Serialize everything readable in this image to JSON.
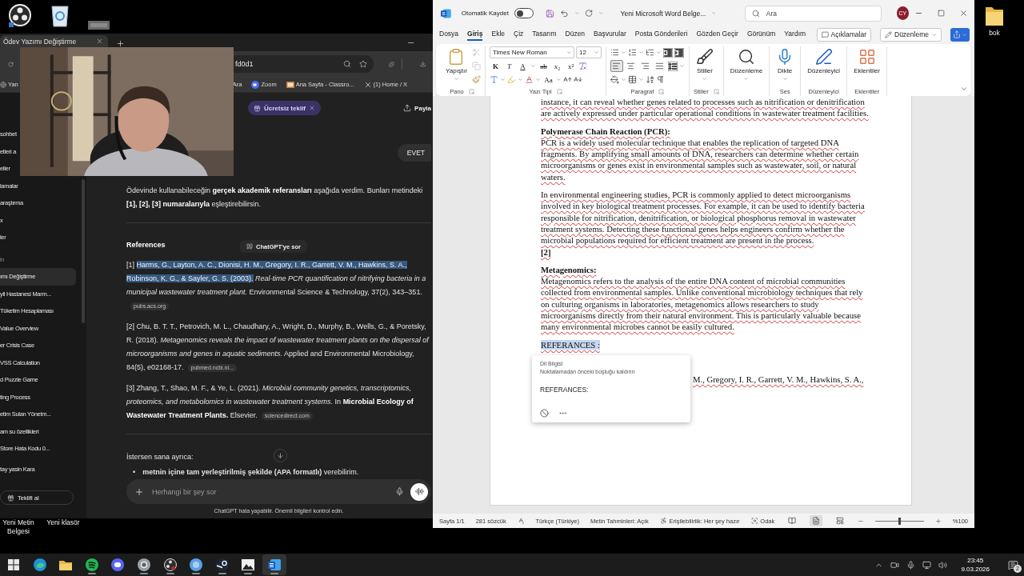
{
  "desktop": {
    "top_icons": [
      {
        "kind": "recorder"
      },
      {
        "kind": "recycle"
      },
      {
        "kind": "thumbnail"
      }
    ],
    "folder": {
      "label": "bok"
    },
    "bottom_icons": [
      {
        "label": "Yeni Metin Belgesi"
      },
      {
        "label": "Yeni klasör"
      }
    ]
  },
  "browser": {
    "tab_title": "Ödev Yazımı Değiştirme",
    "address": "fd0d1",
    "bookmarks": [
      {
        "label": "Yan",
        "kind": "globe"
      },
      {
        "label": "Ara",
        "kind": "plain"
      },
      {
        "label": "Zoom",
        "kind": "video"
      },
      {
        "label": "Ana Sayfa - Classro...",
        "kind": "board"
      },
      {
        "label": "(1) Home / X",
        "kind": "cross"
      }
    ],
    "sidebar": {
      "items": [
        {
          "label": "sohbet",
          "kind": "item",
          "selected": false
        },
        {
          "label": "etleri a",
          "kind": "item",
          "selected": false
        },
        {
          "label": "eller",
          "kind": "item",
          "selected": false
        },
        {
          "label": "lamalar",
          "kind": "item",
          "selected": false
        },
        {
          "label": "araştırma",
          "kind": "item",
          "selected": false
        },
        {
          "label": "x",
          "kind": "item",
          "selected": false
        },
        {
          "label": "ler",
          "kind": "item",
          "selected": false
        },
        {
          "label": "in",
          "kind": "section"
        },
        {
          "label": "ımı Değiştirme",
          "kind": "item",
          "selected": true
        },
        {
          "label": "yli Hastanesi Marm...",
          "kind": "item",
          "selected": false
        },
        {
          "label": "Tüketim Hesaplaması",
          "kind": "item",
          "selected": false
        },
        {
          "label": "Value Overview",
          "kind": "item",
          "selected": false
        },
        {
          "label": "er Crisis Case",
          "kind": "item",
          "selected": false
        },
        {
          "label": "VSS Calculation",
          "kind": "item",
          "selected": false
        },
        {
          "label": "d Puzzle Game",
          "kind": "item",
          "selected": false
        },
        {
          "label": "ting Process",
          "kind": "item",
          "selected": false
        },
        {
          "label": "etim Sulan Yönetm...",
          "kind": "item",
          "selected": false
        },
        {
          "label": "am su özellikleri",
          "kind": "item",
          "selected": false
        },
        {
          "label": "Store Hata Kodu 0...",
          "kind": "item",
          "selected": false
        }
      ],
      "user": "tay yasin Kara",
      "offer_button": "Teklifi al"
    },
    "chat": {
      "offer_pill": "Ücretsiz teklif",
      "share": "Payla",
      "user_message": "EVET",
      "intro": "Ödevinde kullanabileceğin **gerçek akademik referansları** aşağıda verdim. Bunları metindeki **[1], [2], [3] numaralarıyla** eşleştirebilirsin.",
      "references_title": "References",
      "quote_tooltip": "ChatGPT'ye sor",
      "references": [
        {
          "number": "[1]",
          "authors": "Harms, G., Layton, A. C., Dionisi, H. M., Gregory, I. R., Garrett, V. M., Hawkins, S. A., Robinson, K. G., & Sayler, G. S. (2003).",
          "authors_selected": true,
          "rest": "*Real-time PCR quantification of nitrifying bacteria in a municipal wastewater treatment plant.* Environmental Science & Technology, 37(2), 343–351.",
          "source": "pubs.acs.org"
        },
        {
          "number": "[2]",
          "authors": "Chu, B. T. T., Petrovich, M. L., Chaudhary, A., Wright, D., Murphy, B., Wells, G., & Poretsky, R. (2018).",
          "authors_selected": false,
          "rest": "*Metagenomics reveals the impact of wastewater treatment plants on the dispersal of microorganisms and genes in aquatic sediments.* Applied and Environmental Microbiology, 84(5), e02168-17.",
          "source": "pubmed.ncbi.nl..."
        },
        {
          "number": "[3]",
          "authors": "Zhang, T., Shao, M. F., & Ye, L. (2021).",
          "authors_selected": false,
          "rest": "*Microbial community genetics, transcriptomics, proteomics, and metabolomics in wastewater treatment systems.* In **Microbial Ecology of Wastewater Treatment Plants.** Elsevier.",
          "source": "sciencedirect.com"
        }
      ],
      "followup": "İstersen sana ayrıca:",
      "bullets": [
        {
          "marker": "•",
          "text": "**metnin içine tam yerleştirilmiş şekilde (APA formatlı)** verebilirim."
        }
      ],
      "composer": {
        "placeholder": "Herhangi bir şey sor"
      },
      "disclaimer": "ChatGPT hata yapabilir. Önemli bilgileri kontrol edin."
    }
  },
  "word": {
    "autosave_label": "Otomatik Kaydet",
    "autosave_on": false,
    "title": "Yeni Microsoft Word Belge...",
    "search_placeholder": "Ara",
    "avatar": "CY",
    "menu": [
      {
        "label": "Dosya",
        "selected": false
      },
      {
        "label": "Giriş",
        "selected": true
      },
      {
        "label": "Ekle",
        "selected": false
      },
      {
        "label": "Çiz",
        "selected": false
      },
      {
        "label": "Tasarım",
        "selected": false
      },
      {
        "label": "Düzen",
        "selected": false
      },
      {
        "label": "Başvurular",
        "selected": false
      },
      {
        "label": "Posta Gönderileri",
        "selected": false
      },
      {
        "label": "Gözden Geçir",
        "selected": false
      },
      {
        "label": "Görünüm",
        "selected": false
      },
      {
        "label": "Yardım",
        "selected": false
      }
    ],
    "comments_button": "Açıklamalar",
    "editing_button": "Düzenleme",
    "ribbon": [
      {
        "kind": "clipboard",
        "label": "Pano",
        "launcher": true,
        "paste": "Yapıştır",
        "tools": [
          {
            "kind": "cut",
            "disabled": true
          },
          {
            "kind": "copy",
            "disabled": true
          },
          {
            "kind": "painter",
            "disabled": false
          }
        ]
      },
      {
        "kind": "font",
        "label": "Yazı Tipi",
        "launcher": true,
        "font_name": "Times New Roman",
        "font_size": "12",
        "keys": [
          "K",
          "T",
          "A",
          "ab",
          "x₂",
          "x²"
        ],
        "case_key": "Aa"
      },
      {
        "kind": "paragraph",
        "label": "Paragraf",
        "launcher": true,
        "alignments": [
          {
            "kind": "left",
            "selected": true
          },
          {
            "kind": "center",
            "selected": false
          },
          {
            "kind": "right",
            "selected": false
          },
          {
            "kind": "justify",
            "selected": false
          }
        ]
      },
      {
        "kind": "styles",
        "label": "Stiller",
        "launcher": true,
        "button": "Stiller",
        "dropdown": true
      },
      {
        "kind": "find",
        "launcher": false,
        "button": "Düzenleme",
        "dropdown": true
      },
      {
        "kind": "dictate",
        "label": "Ses",
        "launcher": false,
        "button": "Dikte",
        "dropdown": true
      },
      {
        "kind": "editor",
        "label": "Düzenleyici",
        "launcher": false,
        "button": "Düzenleyici",
        "dropdown": false
      },
      {
        "kind": "addins",
        "label": "Eklentiler",
        "launcher": false,
        "button": "Eklentiler",
        "dropdown": false
      }
    ],
    "document": {
      "blocks": [
        {
          "kind": "paragraph",
          "selected": false,
          "text": "instance, it can reveal whether genes related to processes such as nitrification or denitrification are actively expressed under particular operational conditions in wastewater treatment facilities."
        },
        {
          "kind": "heading",
          "selected": false,
          "text": "Polymerase Chain Reaction (PCR):"
        },
        {
          "kind": "body",
          "selected": false,
          "text": "PCR is a widely used molecular technique that enables the replication of targeted DNA fragments. By amplifying small amounts of DNA, researchers can determine whether certain microorganisms or genes exist in environmental samples such as wastewater, soil, or natural waters."
        },
        {
          "kind": "paragraph",
          "selected": false,
          "text": "In environmental engineering studies, PCR is commonly applied to detect microorganisms involved in key biological treatment processes. For example, it can be used to identify bacteria responsible for nitrification, denitrification, or biological phosphorus removal in wastewater treatment systems. Detecting these functional genes helps engineers confirm whether the microbial populations required for efficient treatment are present in the process."
        },
        {
          "kind": "citation",
          "selected": false,
          "text": "[2]"
        },
        {
          "kind": "heading",
          "selected": false,
          "text": "Metagenomics:"
        },
        {
          "kind": "body",
          "selected": false,
          "text": "Metagenomics refers to the analysis of the entire DNA content of microbial communities collected from environmental samples. Unlike conventional microbiology techniques that rely on culturing organisms in laboratories, metagenomics allows researchers to study microorganisms directly from their natural environment. This is particularly valuable because many environmental microbes cannot be easily cultured."
        },
        {
          "kind": "paragraph",
          "selected": true,
          "text": "REFERANCES :"
        },
        {
          "kind": "partial",
          "selected": false,
          "text": "M., Gregory, I. R., Garrett, V. M., Hawkins, S. A.,"
        }
      ]
    },
    "proofing_popup": {
      "title": "Dil Bilgisi",
      "message": "Noktalamadan önceki boşluğu kaldırın",
      "suggestion": "REFERANCES:"
    },
    "status": {
      "page": "Sayfa 1/1",
      "words": "281 sözcük",
      "language": "Türkçe (Türkiye)",
      "predictions": "Metin Tahminleri: Açık",
      "accessibility": "Erişilebilirlik: Her şey hazır",
      "focus": "Odak",
      "views": [
        {
          "kind": "read",
          "selected": false
        },
        {
          "kind": "print",
          "selected": true
        },
        {
          "kind": "web",
          "selected": false
        }
      ],
      "zoom": {
        "level": 0.5,
        "reading": "%100"
      }
    }
  },
  "taskbar": {
    "apps": [
      {
        "kind": "start",
        "selected": false,
        "running": false
      },
      {
        "kind": "edge",
        "selected": false,
        "running": false
      },
      {
        "kind": "explorer",
        "selected": false,
        "running": false
      },
      {
        "kind": "music",
        "selected": false,
        "running": true
      },
      {
        "kind": "chat",
        "selected": false,
        "running": false
      },
      {
        "kind": "chrome",
        "selected": false,
        "running": true
      },
      {
        "kind": "recorder",
        "selected": false,
        "running": true
      },
      {
        "kind": "app",
        "selected": false,
        "running": true
      },
      {
        "kind": "store",
        "selected": false,
        "running": true
      },
      {
        "kind": "photos",
        "selected": false,
        "running": true
      },
      {
        "kind": "word",
        "selected": true,
        "running": true
      }
    ],
    "time": "23:45",
    "date": "9.03.2026",
    "notifications": "2"
  }
}
